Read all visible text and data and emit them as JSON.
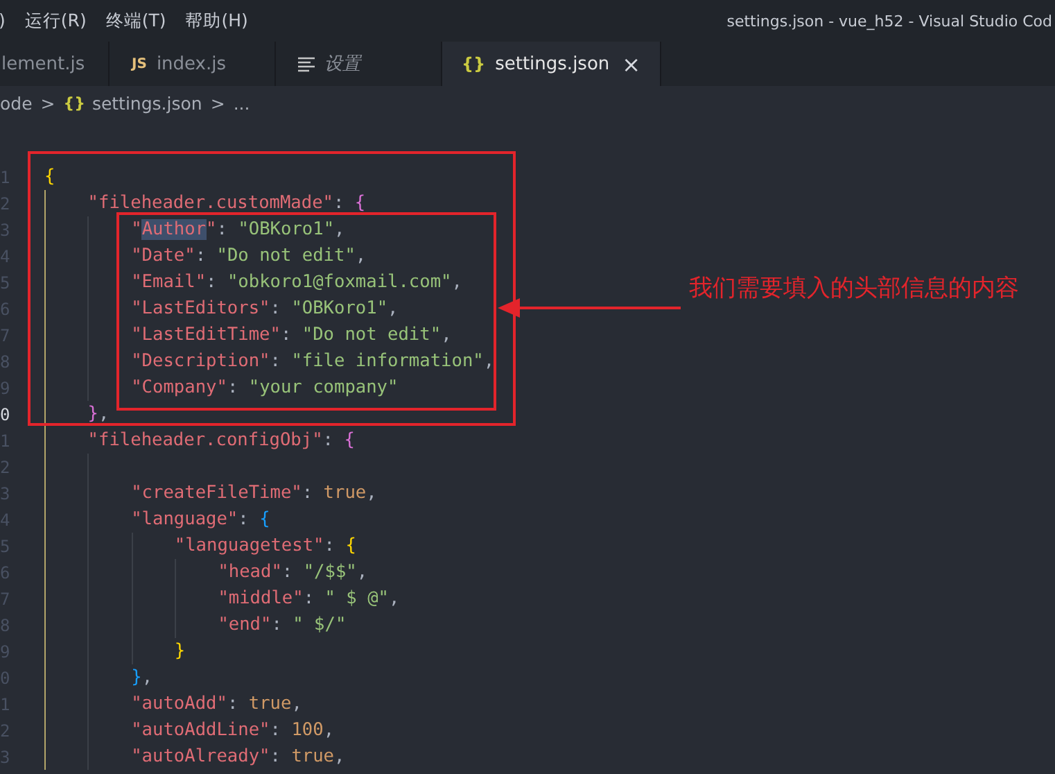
{
  "menu": [
    {
      "label": ")"
    },
    {
      "label": "运行(R)"
    },
    {
      "label": "终端(T)"
    },
    {
      "label": "帮助(H)"
    }
  ],
  "window": {
    "title": "settings.json - vue_h52 - Visual Studio Cod"
  },
  "tabs": [
    {
      "label": "lement.js",
      "kind": "plain",
      "selected": false
    },
    {
      "label": "index.js",
      "kind": "script",
      "icon_text": "JS",
      "selected": false
    },
    {
      "label": "设置",
      "kind": "preferences",
      "selected": false
    },
    {
      "label": "settings.json",
      "kind": "data",
      "icon_text": "{}",
      "selected": true,
      "close_glyph": "×"
    }
  ],
  "breadcrumb": [
    {
      "kind": "text",
      "label": "ode"
    },
    {
      "kind": "sep",
      "label": ">"
    },
    {
      "kind": "data",
      "icon_text": "{}",
      "label": "settings.json"
    },
    {
      "kind": "sep",
      "label": ">"
    },
    {
      "kind": "text",
      "label": "..."
    }
  ],
  "lines": [
    {
      "number": "1",
      "current": false,
      "tokens": [
        {
          "kind": "brace1",
          "text": "{"
        }
      ],
      "children": [
        {
          "number": "2",
          "current": false,
          "tokens": [
            {
              "kind": "key",
              "text": "\"fileheader.customMade\""
            },
            {
              "kind": "punct",
              "text": ": "
            },
            {
              "kind": "brace2",
              "text": "{"
            }
          ],
          "children": [
            {
              "number": "3",
              "current": false,
              "tokens": [
                {
                  "kind": "key",
                  "text": "\"",
                  "highlighted": false
                },
                {
                  "kind": "key",
                  "text": "Author",
                  "highlighted": true
                },
                {
                  "kind": "key",
                  "text": "\"",
                  "highlighted": false
                },
                {
                  "kind": "punct",
                  "text": ": "
                },
                {
                  "kind": "string",
                  "text": "\"OBKoro1\""
                },
                {
                  "kind": "punct",
                  "text": ","
                }
              ]
            },
            {
              "number": "4",
              "current": false,
              "tokens": [
                {
                  "kind": "key",
                  "text": "\"Date\""
                },
                {
                  "kind": "punct",
                  "text": ": "
                },
                {
                  "kind": "string",
                  "text": "\"Do not edit\""
                },
                {
                  "kind": "punct",
                  "text": ","
                }
              ]
            },
            {
              "number": "5",
              "current": false,
              "tokens": [
                {
                  "kind": "key",
                  "text": "\"Email\""
                },
                {
                  "kind": "punct",
                  "text": ": "
                },
                {
                  "kind": "string",
                  "text": "\"obkoro1@foxmail.com\""
                },
                {
                  "kind": "punct",
                  "text": ","
                }
              ]
            },
            {
              "number": "6",
              "current": false,
              "tokens": [
                {
                  "kind": "key",
                  "text": "\"LastEditors\""
                },
                {
                  "kind": "punct",
                  "text": ": "
                },
                {
                  "kind": "string",
                  "text": "\"OBKoro1\""
                },
                {
                  "kind": "punct",
                  "text": ","
                }
              ]
            },
            {
              "number": "7",
              "current": false,
              "tokens": [
                {
                  "kind": "key",
                  "text": "\"LastEditTime\""
                },
                {
                  "kind": "punct",
                  "text": ": "
                },
                {
                  "kind": "string",
                  "text": "\"Do not edit\""
                },
                {
                  "kind": "punct",
                  "text": ","
                }
              ]
            },
            {
              "number": "8",
              "current": false,
              "tokens": [
                {
                  "kind": "key",
                  "text": "\"Description\""
                },
                {
                  "kind": "punct",
                  "text": ": "
                },
                {
                  "kind": "string",
                  "text": "\"file information\""
                },
                {
                  "kind": "punct",
                  "text": ","
                }
              ]
            },
            {
              "number": "9",
              "current": false,
              "tokens": [
                {
                  "kind": "key",
                  "text": "\"Company\""
                },
                {
                  "kind": "punct",
                  "text": ": "
                },
                {
                  "kind": "string",
                  "text": "\"your company\""
                }
              ]
            }
          ]
        },
        {
          "number": "0",
          "current": true,
          "tokens": [
            {
              "kind": "brace2",
              "text": "}"
            },
            {
              "kind": "punct",
              "text": ","
            }
          ]
        },
        {
          "number": "1",
          "current": false,
          "tokens": [
            {
              "kind": "key",
              "text": "\"fileheader.configObj\""
            },
            {
              "kind": "punct",
              "text": ": "
            },
            {
              "kind": "brace2",
              "text": "{"
            }
          ],
          "children": [
            {
              "number": "2",
              "current": false
            },
            {
              "number": "3",
              "current": false,
              "tokens": [
                {
                  "kind": "key",
                  "text": "\"createFileTime\""
                },
                {
                  "kind": "punct",
                  "text": ": "
                },
                {
                  "kind": "literal",
                  "text": "true"
                },
                {
                  "kind": "punct",
                  "text": ","
                }
              ]
            },
            {
              "number": "4",
              "current": false,
              "tokens": [
                {
                  "kind": "key",
                  "text": "\"language\""
                },
                {
                  "kind": "punct",
                  "text": ": "
                },
                {
                  "kind": "brace3",
                  "text": "{"
                }
              ],
              "children": [
                {
                  "number": "5",
                  "current": false,
                  "tokens": [
                    {
                      "kind": "key",
                      "text": "\"languagetest\""
                    },
                    {
                      "kind": "punct",
                      "text": ": "
                    },
                    {
                      "kind": "brace1",
                      "text": "{"
                    }
                  ],
                  "children": [
                    {
                      "number": "6",
                      "current": false,
                      "tokens": [
                        {
                          "kind": "key",
                          "text": "\"head\""
                        },
                        {
                          "kind": "punct",
                          "text": ": "
                        },
                        {
                          "kind": "string",
                          "text": "\"/$$\""
                        },
                        {
                          "kind": "punct",
                          "text": ","
                        }
                      ]
                    },
                    {
                      "number": "7",
                      "current": false,
                      "tokens": [
                        {
                          "kind": "key",
                          "text": "\"middle\""
                        },
                        {
                          "kind": "punct",
                          "text": ": "
                        },
                        {
                          "kind": "string",
                          "text": "\" $ @\""
                        },
                        {
                          "kind": "punct",
                          "text": ","
                        }
                      ]
                    },
                    {
                      "number": "8",
                      "current": false,
                      "tokens": [
                        {
                          "kind": "key",
                          "text": "\"end\""
                        },
                        {
                          "kind": "punct",
                          "text": ": "
                        },
                        {
                          "kind": "string",
                          "text": "\" $/\""
                        }
                      ]
                    }
                  ]
                },
                {
                  "number": "9",
                  "current": false,
                  "tokens": [
                    {
                      "kind": "brace1",
                      "text": "}"
                    }
                  ]
                }
              ]
            },
            {
              "number": "0",
              "current": false,
              "tokens": [
                {
                  "kind": "brace3",
                  "text": "}"
                },
                {
                  "kind": "punct",
                  "text": ","
                }
              ]
            },
            {
              "number": "1",
              "current": false,
              "tokens": [
                {
                  "kind": "key",
                  "text": "\"autoAdd\""
                },
                {
                  "kind": "punct",
                  "text": ": "
                },
                {
                  "kind": "literal",
                  "text": "true"
                },
                {
                  "kind": "punct",
                  "text": ","
                }
              ]
            },
            {
              "number": "2",
              "current": false,
              "tokens": [
                {
                  "kind": "key",
                  "text": "\"autoAddLine\""
                },
                {
                  "kind": "punct",
                  "text": ": "
                },
                {
                  "kind": "literal",
                  "text": "100"
                },
                {
                  "kind": "punct",
                  "text": ","
                }
              ]
            },
            {
              "number": "3",
              "current": false,
              "tokens": [
                {
                  "kind": "key",
                  "text": "\"autoAlready\""
                },
                {
                  "kind": "punct",
                  "text": ": "
                },
                {
                  "kind": "literal",
                  "text": "true"
                },
                {
                  "kind": "punct",
                  "text": ","
                }
              ]
            }
          ]
        }
      ]
    }
  ],
  "annotation": {
    "text": "我们需要填入的头部信息的内容"
  }
}
